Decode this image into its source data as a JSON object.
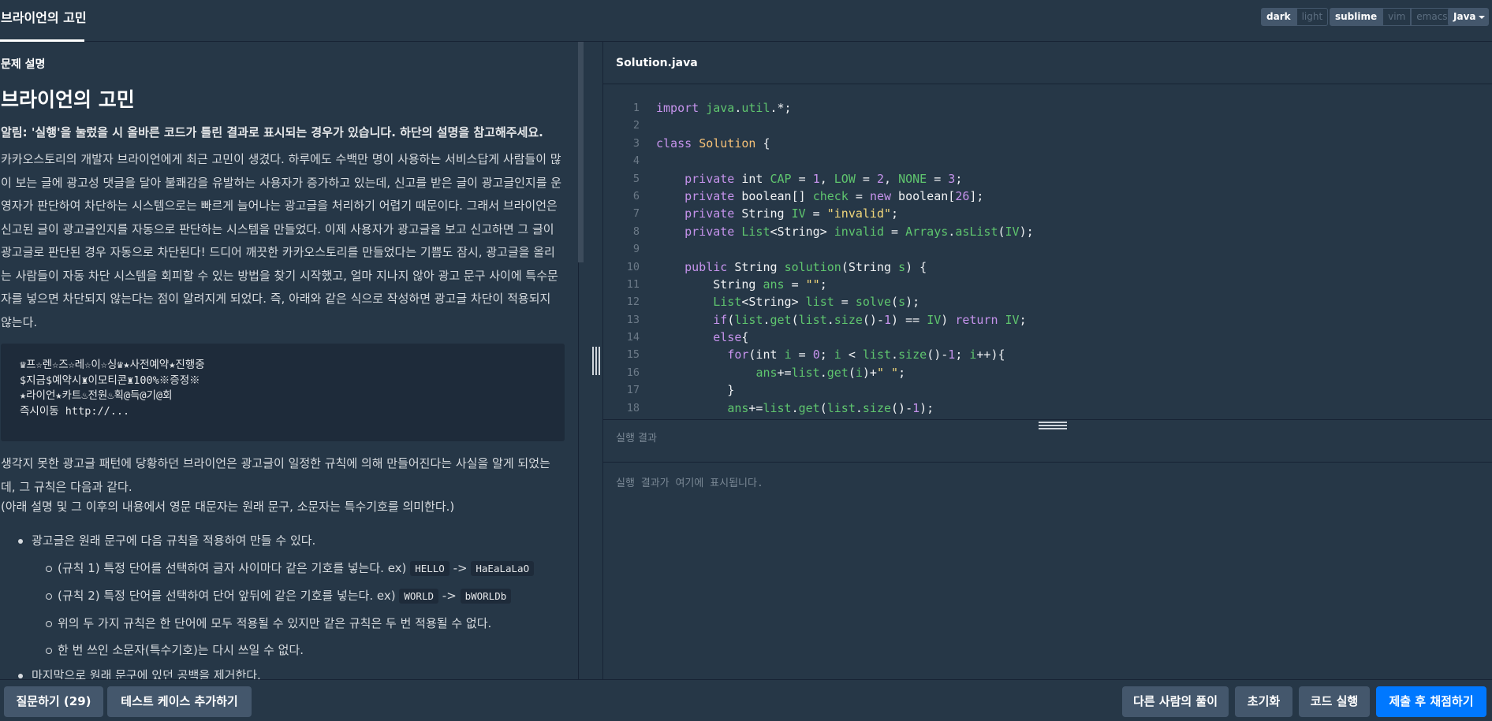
{
  "header": {
    "title_tab": "브라이언의 고민",
    "theme": {
      "dark": "dark",
      "light": "light"
    },
    "keymap": {
      "sublime": "sublime",
      "vim": "vim",
      "emacs": "emacs"
    },
    "language": "Java"
  },
  "description": {
    "section_title": "문제 설명",
    "title": "브라이언의 고민",
    "notice": "알림: '실행'을 눌렀을 시 올바른 코드가 틀린 결과로 표시되는 경우가 있습니다. 하단의 설명을 참고해주세요.",
    "para1": "카카오스토리의 개발자 브라이언에게 최근 고민이 생겼다. 하루에도 수백만 명이 사용하는 서비스답게 사람들이 많이 보는 글에 광고성 댓글을 달아 불쾌감을 유발하는 사용자가 증가하고 있는데, 신고를 받은 글이 광고글인지를 운영자가 판단하여 차단하는 시스템으로는 빠르게 늘어나는 광고글을 처리하기 어렵기 때문이다. 그래서 브라이언은 신고된 글이 광고글인지를 자동으로 판단하는 시스템을 만들었다. 이제 사용자가 광고글을 보고 신고하면 그 글이 광고글로 판단된 경우 자동으로 차단된다! 드디어 깨끗한 카카오스토리를 만들었다는 기쁨도 잠시, 광고글을 올리는 사람들이 자동 차단 시스템을 회피할 수 있는 방법을 찾기 시작했고, 얼마 지나지 않아 광고 문구 사이에 특수문자를 넣으면 차단되지 않는다는 점이 알려지게 되었다. 즉, 아래와 같은 식으로 작성하면 광고글 차단이 적용되지 않는다.",
    "example_lines": [
      "♛프☆렌☆즈☆레☆이☆싱♛★사전예약★진행중",
      "$지금$예약시♜이모티콘♜100%※증정※",
      "★라이언★카트♨전원♨획@득@기@회",
      "즉시이동 http://..."
    ],
    "para2": "생각지 못한 광고글 패턴에 당황하던 브라이언은 광고글이 일정한 규칙에 의해 만들어진다는 사실을 알게 되었는데, 그 규칙은 다음과 같다.",
    "para3": "(아래 설명 및 그 이후의 내용에서 영문 대문자는 원래 문구, 소문자는 특수기호를 의미한다.)",
    "rule_main": "광고글은 원래 문구에 다음 규칙을 적용하여 만들 수 있다.",
    "rule1_text": "(규칙 1) 특정 단어를 선택하여 글자 사이마다 같은 기호를 넣는다. ex)",
    "rule1_from": "HELLO",
    "rule1_arrow": "->",
    "rule1_to": "HaEaLaLaO",
    "rule2_text": "(규칙 2) 특정 단어를 선택하여 단어 앞뒤에 같은 기호를 넣는다. ex)",
    "rule2_from": "WORLD",
    "rule2_arrow": "->",
    "rule2_to": "bWORLDb",
    "rule3_text": "위의 두 가지 규칙은 한 단어에 모두 적용될 수 있지만 같은 규칙은 두 번 적용될 수 없다.",
    "rule4_text": "한 번 쓰인 소문자(특수기호)는 다시 쓰일 수 없다.",
    "rule_last": "마지막으로 원래 문구에 있던 공백을 제거한다."
  },
  "editor": {
    "filename": "Solution.java",
    "line_numbers": [
      "1",
      "2",
      "3",
      "4",
      "5",
      "6",
      "7",
      "8",
      "9",
      "10",
      "11",
      "12",
      "13",
      "14",
      "15",
      "16",
      "17",
      "18"
    ]
  },
  "result": {
    "title": "실행 결과",
    "placeholder": "실행 결과가 여기에 표시됩니다."
  },
  "footer": {
    "question_button": "질문하기 (29)",
    "add_testcase_button": "테스트 케이스 추가하기",
    "others_solution_button": "다른 사람의 풀이",
    "reset_button": "초기화",
    "run_button": "코드 실행",
    "submit_button": "제출 후 채점하기"
  },
  "colors": {
    "background": "#263747",
    "code_block": "#1e2b3a",
    "button": "#44576c",
    "primary": "#0078ff",
    "keyword": "#c693ec",
    "class_name": "#f6c177",
    "string": "#f2d77b",
    "identifier_green": "#5fc56e"
  }
}
